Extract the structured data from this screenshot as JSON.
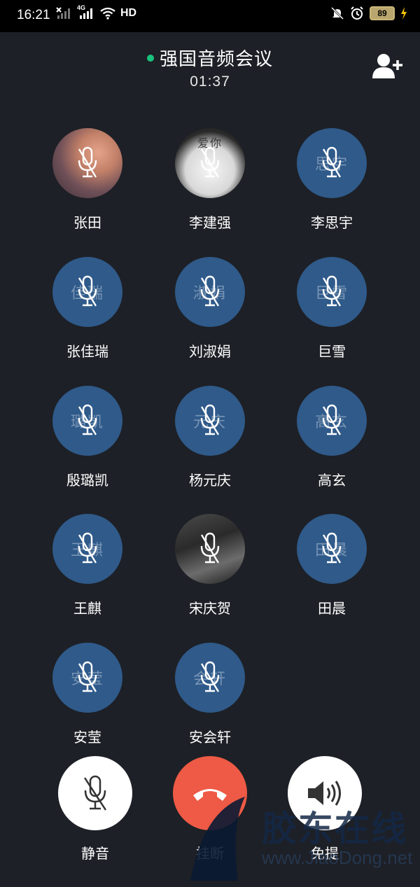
{
  "status_bar": {
    "time": "16:21",
    "network": "4G",
    "hd": "HD",
    "battery": "89"
  },
  "header": {
    "title": "强国音频会议",
    "duration": "01:37"
  },
  "members": [
    {
      "name": "张田",
      "avatar_text": "",
      "avatar_type": "photo1"
    },
    {
      "name": "李建强",
      "avatar_text": "爱你",
      "avatar_type": "photo2"
    },
    {
      "name": "李思宇",
      "avatar_text": "思宇",
      "avatar_type": "initials"
    },
    {
      "name": "张佳瑞",
      "avatar_text": "佳瑞",
      "avatar_type": "initials"
    },
    {
      "name": "刘淑娟",
      "avatar_text": "淑娟",
      "avatar_type": "initials"
    },
    {
      "name": "巨雪",
      "avatar_text": "巨雪",
      "avatar_type": "initials"
    },
    {
      "name": "殷璐凯",
      "avatar_text": "璐凯",
      "avatar_type": "initials"
    },
    {
      "name": "杨元庆",
      "avatar_text": "元庆",
      "avatar_type": "initials"
    },
    {
      "name": "高玄",
      "avatar_text": "高玄",
      "avatar_type": "initials"
    },
    {
      "name": "王麒",
      "avatar_text": "王麒",
      "avatar_type": "initials"
    },
    {
      "name": "宋庆贺",
      "avatar_text": "",
      "avatar_type": "photo3"
    },
    {
      "name": "田晨",
      "avatar_text": "田晨",
      "avatar_type": "initials"
    },
    {
      "name": "安莹",
      "avatar_text": "安莹",
      "avatar_type": "initials"
    },
    {
      "name": "安会轩",
      "avatar_text": "会轩",
      "avatar_type": "initials"
    }
  ],
  "controls": {
    "mute_label": "静音",
    "hangup_label": "挂断",
    "speaker_label": "免提"
  },
  "watermark": {
    "text": "胶东在线",
    "url": "www.JiaoDong.net"
  },
  "colors": {
    "background": "#1d2026",
    "avatar": "#2f5a8a",
    "online": "#19c37d",
    "hangup": "#ee5a45"
  }
}
